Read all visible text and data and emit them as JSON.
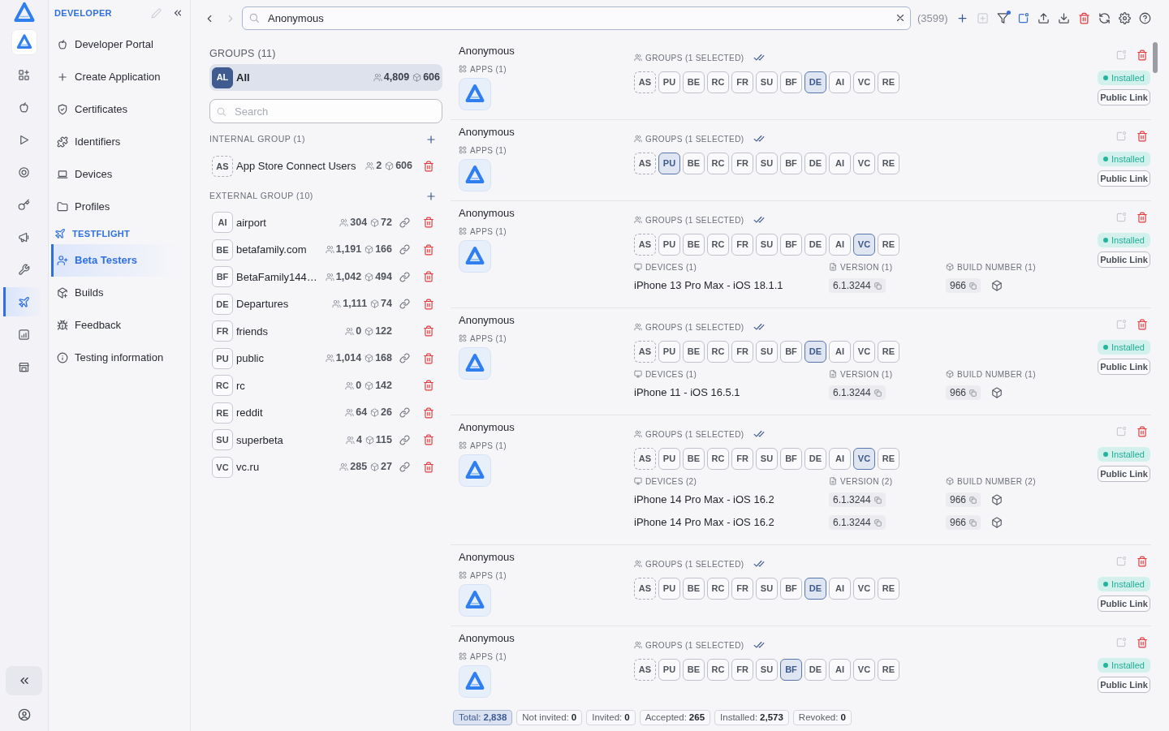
{
  "rail": {
    "items": [
      {
        "selected": false
      },
      {
        "selected": false
      },
      {
        "selected": false
      },
      {
        "selected": false
      },
      {
        "selected": false
      },
      {
        "selected": false
      },
      {
        "selected": false
      },
      {
        "selected": true
      },
      {
        "selected": false
      },
      {
        "selected": false
      }
    ]
  },
  "sidebar": {
    "title": "DEVELOPER",
    "items": [
      {
        "label": "Developer Portal",
        "selected": false
      },
      {
        "label": "Create Application",
        "selected": false
      },
      {
        "label": "Certificates",
        "selected": false
      },
      {
        "label": "Identifiers",
        "selected": false
      },
      {
        "label": "Devices",
        "selected": false
      },
      {
        "label": "Profiles",
        "selected": false
      }
    ],
    "section": {
      "title": "TESTFLIGHT",
      "items": [
        {
          "label": "Beta Testers",
          "selected": true
        },
        {
          "label": "Builds",
          "selected": false
        },
        {
          "label": "Feedback",
          "selected": false
        },
        {
          "label": "Testing information",
          "selected": false
        }
      ]
    }
  },
  "top_bar": {
    "navigation": [
      {
        "disabled": false
      },
      {
        "disabled": true
      }
    ],
    "search": {
      "value": "Anonymous"
    },
    "result_count": "(3599)",
    "toolbar": [
      {
        "disabled": false,
        "indicator": false
      },
      {
        "disabled": true,
        "indicator": false
      },
      {
        "disabled": false,
        "indicator": true
      },
      {
        "disabled": false,
        "indicator": false
      },
      {
        "disabled": false,
        "indicator": false
      },
      {
        "disabled": false,
        "indicator": false
      },
      {
        "disabled": false,
        "indicator": false
      },
      {
        "disabled": false,
        "indicator": false
      },
      {
        "disabled": false,
        "indicator": false
      },
      {
        "disabled": false,
        "indicator": false
      }
    ]
  },
  "groups": {
    "title": "GROUPS (11)",
    "all": {
      "badge": "AL",
      "name": "All",
      "testers": "4,809",
      "builds": "606",
      "selected": true
    },
    "search": {
      "placeholder": "Search"
    },
    "sections": [
      {
        "title": "INTERNAL GROUP (1)",
        "items": [
          {
            "badge": "AS",
            "name": "App Store Connect Users",
            "testers": "2",
            "builds": "606",
            "kind": "internal",
            "public_link": false,
            "selected": false
          }
        ]
      },
      {
        "title": "EXTERNAL GROUP (10)",
        "items": [
          {
            "badge": "AI",
            "name": "airport",
            "testers": "304",
            "builds": "72",
            "kind": "external",
            "public_link": true,
            "selected": false
          },
          {
            "badge": "BE",
            "name": "betafamily.com",
            "testers": "1,191",
            "builds": "166",
            "kind": "external",
            "public_link": true,
            "selected": false
          },
          {
            "badge": "BF",
            "name": "BetaFamily144…",
            "testers": "1,042",
            "builds": "494",
            "kind": "external",
            "public_link": true,
            "selected": false
          },
          {
            "badge": "DE",
            "name": "Departures",
            "testers": "1,111",
            "builds": "74",
            "kind": "external",
            "public_link": true,
            "selected": false
          },
          {
            "badge": "FR",
            "name": "friends",
            "testers": "0",
            "builds": "122",
            "kind": "external",
            "public_link": false,
            "selected": false
          },
          {
            "badge": "PU",
            "name": "public",
            "testers": "1,014",
            "builds": "168",
            "kind": "external",
            "public_link": true,
            "selected": false
          },
          {
            "badge": "RC",
            "name": "rc",
            "testers": "0",
            "builds": "142",
            "kind": "external",
            "public_link": false,
            "selected": false
          },
          {
            "badge": "RE",
            "name": "reddit",
            "testers": "64",
            "builds": "26",
            "kind": "external",
            "public_link": true,
            "selected": false
          },
          {
            "badge": "SU",
            "name": "superbeta",
            "testers": "4",
            "builds": "115",
            "kind": "external",
            "public_link": true,
            "selected": false
          },
          {
            "badge": "VC",
            "name": "vc.ru",
            "testers": "285",
            "builds": "27",
            "kind": "external",
            "public_link": true,
            "selected": false
          }
        ]
      }
    ]
  },
  "testers": [
    {
      "name": "Anonymous",
      "apps_label": "APPS (1)",
      "groups_label": "GROUPS (1 SELECTED)",
      "groups": [
        {
          "label": "AS",
          "kind": "internal",
          "selected": false
        },
        {
          "label": "PU",
          "kind": "external",
          "selected": false
        },
        {
          "label": "BE",
          "kind": "external",
          "selected": false
        },
        {
          "label": "RC",
          "kind": "external",
          "selected": false
        },
        {
          "label": "FR",
          "kind": "external",
          "selected": false
        },
        {
          "label": "SU",
          "kind": "external",
          "selected": false
        },
        {
          "label": "BF",
          "kind": "external",
          "selected": false
        },
        {
          "label": "DE",
          "kind": "external",
          "selected": true
        },
        {
          "label": "AI",
          "kind": "external",
          "selected": false
        },
        {
          "label": "VC",
          "kind": "external",
          "selected": false
        },
        {
          "label": "RE",
          "kind": "external",
          "selected": false
        }
      ],
      "status": "Installed",
      "link_button": "Public Link"
    },
    {
      "name": "Anonymous",
      "apps_label": "APPS (1)",
      "groups_label": "GROUPS (1 SELECTED)",
      "groups": [
        {
          "label": "AS",
          "kind": "internal",
          "selected": false
        },
        {
          "label": "PU",
          "kind": "external",
          "selected": true
        },
        {
          "label": "BE",
          "kind": "external",
          "selected": false
        },
        {
          "label": "RC",
          "kind": "external",
          "selected": false
        },
        {
          "label": "FR",
          "kind": "external",
          "selected": false
        },
        {
          "label": "SU",
          "kind": "external",
          "selected": false
        },
        {
          "label": "BF",
          "kind": "external",
          "selected": false
        },
        {
          "label": "DE",
          "kind": "external",
          "selected": false
        },
        {
          "label": "AI",
          "kind": "external",
          "selected": false
        },
        {
          "label": "VC",
          "kind": "external",
          "selected": false
        },
        {
          "label": "RE",
          "kind": "external",
          "selected": false
        }
      ],
      "status": "Installed",
      "link_button": "Public Link"
    },
    {
      "name": "Anonymous",
      "apps_label": "APPS (1)",
      "groups_label": "GROUPS (1 SELECTED)",
      "groups": [
        {
          "label": "AS",
          "kind": "internal",
          "selected": false
        },
        {
          "label": "PU",
          "kind": "external",
          "selected": false
        },
        {
          "label": "BE",
          "kind": "external",
          "selected": false
        },
        {
          "label": "RC",
          "kind": "external",
          "selected": false
        },
        {
          "label": "FR",
          "kind": "external",
          "selected": false
        },
        {
          "label": "SU",
          "kind": "external",
          "selected": false
        },
        {
          "label": "BF",
          "kind": "external",
          "selected": false
        },
        {
          "label": "DE",
          "kind": "external",
          "selected": false
        },
        {
          "label": "AI",
          "kind": "external",
          "selected": false
        },
        {
          "label": "VC",
          "kind": "external",
          "selected": true
        },
        {
          "label": "RE",
          "kind": "external",
          "selected": false
        }
      ],
      "devices": {
        "columns": [
          "DEVICES (1)",
          "VERSION (1)",
          "BUILD NUMBER (1)"
        ],
        "rows": [
          {
            "device": "iPhone 13 Pro Max - iOS 18.1.1",
            "version": "6.1.3244",
            "build": "966"
          }
        ]
      },
      "status": "Installed",
      "link_button": "Public Link"
    },
    {
      "name": "Anonymous",
      "apps_label": "APPS (1)",
      "groups_label": "GROUPS (1 SELECTED)",
      "groups": [
        {
          "label": "AS",
          "kind": "internal",
          "selected": false
        },
        {
          "label": "PU",
          "kind": "external",
          "selected": false
        },
        {
          "label": "BE",
          "kind": "external",
          "selected": false
        },
        {
          "label": "RC",
          "kind": "external",
          "selected": false
        },
        {
          "label": "FR",
          "kind": "external",
          "selected": false
        },
        {
          "label": "SU",
          "kind": "external",
          "selected": false
        },
        {
          "label": "BF",
          "kind": "external",
          "selected": false
        },
        {
          "label": "DE",
          "kind": "external",
          "selected": true
        },
        {
          "label": "AI",
          "kind": "external",
          "selected": false
        },
        {
          "label": "VC",
          "kind": "external",
          "selected": false
        },
        {
          "label": "RE",
          "kind": "external",
          "selected": false
        }
      ],
      "devices": {
        "columns": [
          "DEVICES (1)",
          "VERSION (1)",
          "BUILD NUMBER (1)"
        ],
        "rows": [
          {
            "device": "iPhone 11 - iOS 16.5.1",
            "version": "6.1.3244",
            "build": "966"
          }
        ]
      },
      "status": "Installed",
      "link_button": "Public Link"
    },
    {
      "name": "Anonymous",
      "apps_label": "APPS (1)",
      "groups_label": "GROUPS (1 SELECTED)",
      "groups": [
        {
          "label": "AS",
          "kind": "internal",
          "selected": false
        },
        {
          "label": "PU",
          "kind": "external",
          "selected": false
        },
        {
          "label": "BE",
          "kind": "external",
          "selected": false
        },
        {
          "label": "RC",
          "kind": "external",
          "selected": false
        },
        {
          "label": "FR",
          "kind": "external",
          "selected": false
        },
        {
          "label": "SU",
          "kind": "external",
          "selected": false
        },
        {
          "label": "BF",
          "kind": "external",
          "selected": false
        },
        {
          "label": "DE",
          "kind": "external",
          "selected": false
        },
        {
          "label": "AI",
          "kind": "external",
          "selected": false
        },
        {
          "label": "VC",
          "kind": "external",
          "selected": true
        },
        {
          "label": "RE",
          "kind": "external",
          "selected": false
        }
      ],
      "devices": {
        "columns": [
          "DEVICES (2)",
          "VERSION (2)",
          "BUILD NUMBER (2)"
        ],
        "rows": [
          {
            "device": "iPhone 14 Pro Max - iOS 16.2",
            "version": "6.1.3244",
            "build": "966"
          },
          {
            "device": "iPhone 14 Pro Max - iOS 16.2",
            "version": "6.1.3244",
            "build": "966"
          }
        ]
      },
      "status": "Installed",
      "link_button": "Public Link"
    },
    {
      "name": "Anonymous",
      "apps_label": "APPS (1)",
      "groups_label": "GROUPS (1 SELECTED)",
      "groups": [
        {
          "label": "AS",
          "kind": "internal",
          "selected": false
        },
        {
          "label": "PU",
          "kind": "external",
          "selected": false
        },
        {
          "label": "BE",
          "kind": "external",
          "selected": false
        },
        {
          "label": "RC",
          "kind": "external",
          "selected": false
        },
        {
          "label": "FR",
          "kind": "external",
          "selected": false
        },
        {
          "label": "SU",
          "kind": "external",
          "selected": false
        },
        {
          "label": "BF",
          "kind": "external",
          "selected": false
        },
        {
          "label": "DE",
          "kind": "external",
          "selected": true
        },
        {
          "label": "AI",
          "kind": "external",
          "selected": false
        },
        {
          "label": "VC",
          "kind": "external",
          "selected": false
        },
        {
          "label": "RE",
          "kind": "external",
          "selected": false
        }
      ],
      "status": "Installed",
      "link_button": "Public Link"
    },
    {
      "name": "Anonymous",
      "apps_label": "APPS (1)",
      "groups_label": "GROUPS (1 SELECTED)",
      "groups": [
        {
          "label": "AS",
          "kind": "internal",
          "selected": false
        },
        {
          "label": "PU",
          "kind": "external",
          "selected": false
        },
        {
          "label": "BE",
          "kind": "external",
          "selected": false
        },
        {
          "label": "RC",
          "kind": "external",
          "selected": false
        },
        {
          "label": "FR",
          "kind": "external",
          "selected": false
        },
        {
          "label": "SU",
          "kind": "external",
          "selected": false
        },
        {
          "label": "BF",
          "kind": "external",
          "selected": true
        },
        {
          "label": "DE",
          "kind": "external",
          "selected": false
        },
        {
          "label": "AI",
          "kind": "external",
          "selected": false
        },
        {
          "label": "VC",
          "kind": "external",
          "selected": false
        },
        {
          "label": "RE",
          "kind": "external",
          "selected": false
        }
      ],
      "status": "Installed",
      "link_button": "Public Link"
    }
  ],
  "stats": [
    {
      "label": "Total:",
      "value": "2,838",
      "selected": true
    },
    {
      "label": "Not invited:",
      "value": "0",
      "selected": false
    },
    {
      "label": "Invited:",
      "value": "0",
      "selected": false
    },
    {
      "label": "Accepted:",
      "value": "265",
      "selected": false
    },
    {
      "label": "Installed:",
      "value": "2,573",
      "selected": false
    },
    {
      "label": "Revoked:",
      "value": "0",
      "selected": false
    }
  ]
}
